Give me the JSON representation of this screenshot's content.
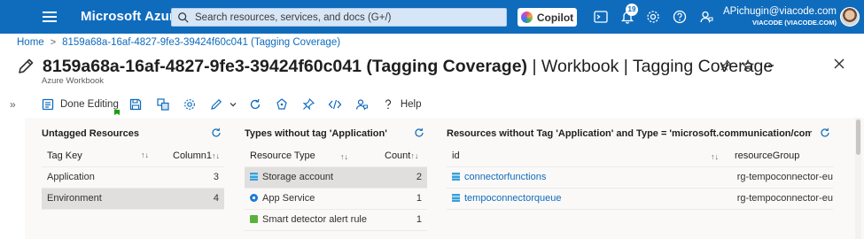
{
  "header": {
    "brand": "Microsoft Azure",
    "search_placeholder": "Search resources, services, and docs (G+/)",
    "copilot_label": "Copilot",
    "notification_count": "19",
    "account_email": "APichugin@viacode.com",
    "account_org": "VIACODE (VIACODE.COM)",
    "colors": {
      "bar": "#0f6cbd"
    }
  },
  "breadcrumb": {
    "items": [
      "Home",
      "8159a68a-16af-4827-9fe3-39424f60c041 (Tagging Coverage)"
    ]
  },
  "page": {
    "title_bold": "8159a68a-16af-4827-9fe3-39424f60c041 (Tagging Coverage)",
    "title_rest": " | Workbook | Tagging Coverage",
    "subtitle": "Azure Workbook"
  },
  "toolbar": {
    "done_editing": "Done Editing",
    "help": "Help",
    "icons": [
      "save-icon",
      "clone-icon",
      "settings-icon",
      "edit-icon",
      "chevron-down-icon",
      "refresh-icon",
      "feedback-icon",
      "pin-icon",
      "code-icon",
      "community-icon",
      "help-icon"
    ]
  },
  "panels": {
    "untagged": {
      "title": "Untagged Resources",
      "columns": [
        "Tag Key",
        "Column1"
      ],
      "rows": [
        {
          "key": "Application",
          "value": "3"
        },
        {
          "key": "Environment",
          "value": "4"
        }
      ]
    },
    "types": {
      "title": "Types without tag 'Application'",
      "columns": [
        "Resource Type",
        "Count"
      ],
      "rows": [
        {
          "type": "Storage account",
          "count": "2",
          "icon": "storage-icon"
        },
        {
          "type": "App Service",
          "count": "1",
          "icon": "app-service-icon"
        },
        {
          "type": "Smart detector alert rule",
          "count": "1",
          "icon": "alert-rule-icon"
        }
      ]
    },
    "resources": {
      "title": "Resources without Tag 'Application' and Type = 'microsoft.communication/commun",
      "columns": [
        "id",
        "resourceGroup"
      ],
      "rows": [
        {
          "id": "connectorfunctions",
          "group": "rg-tempoconnector-eu"
        },
        {
          "id": "tempoconnectorqueue",
          "group": "rg-tempoconnector-eu"
        }
      ]
    }
  }
}
